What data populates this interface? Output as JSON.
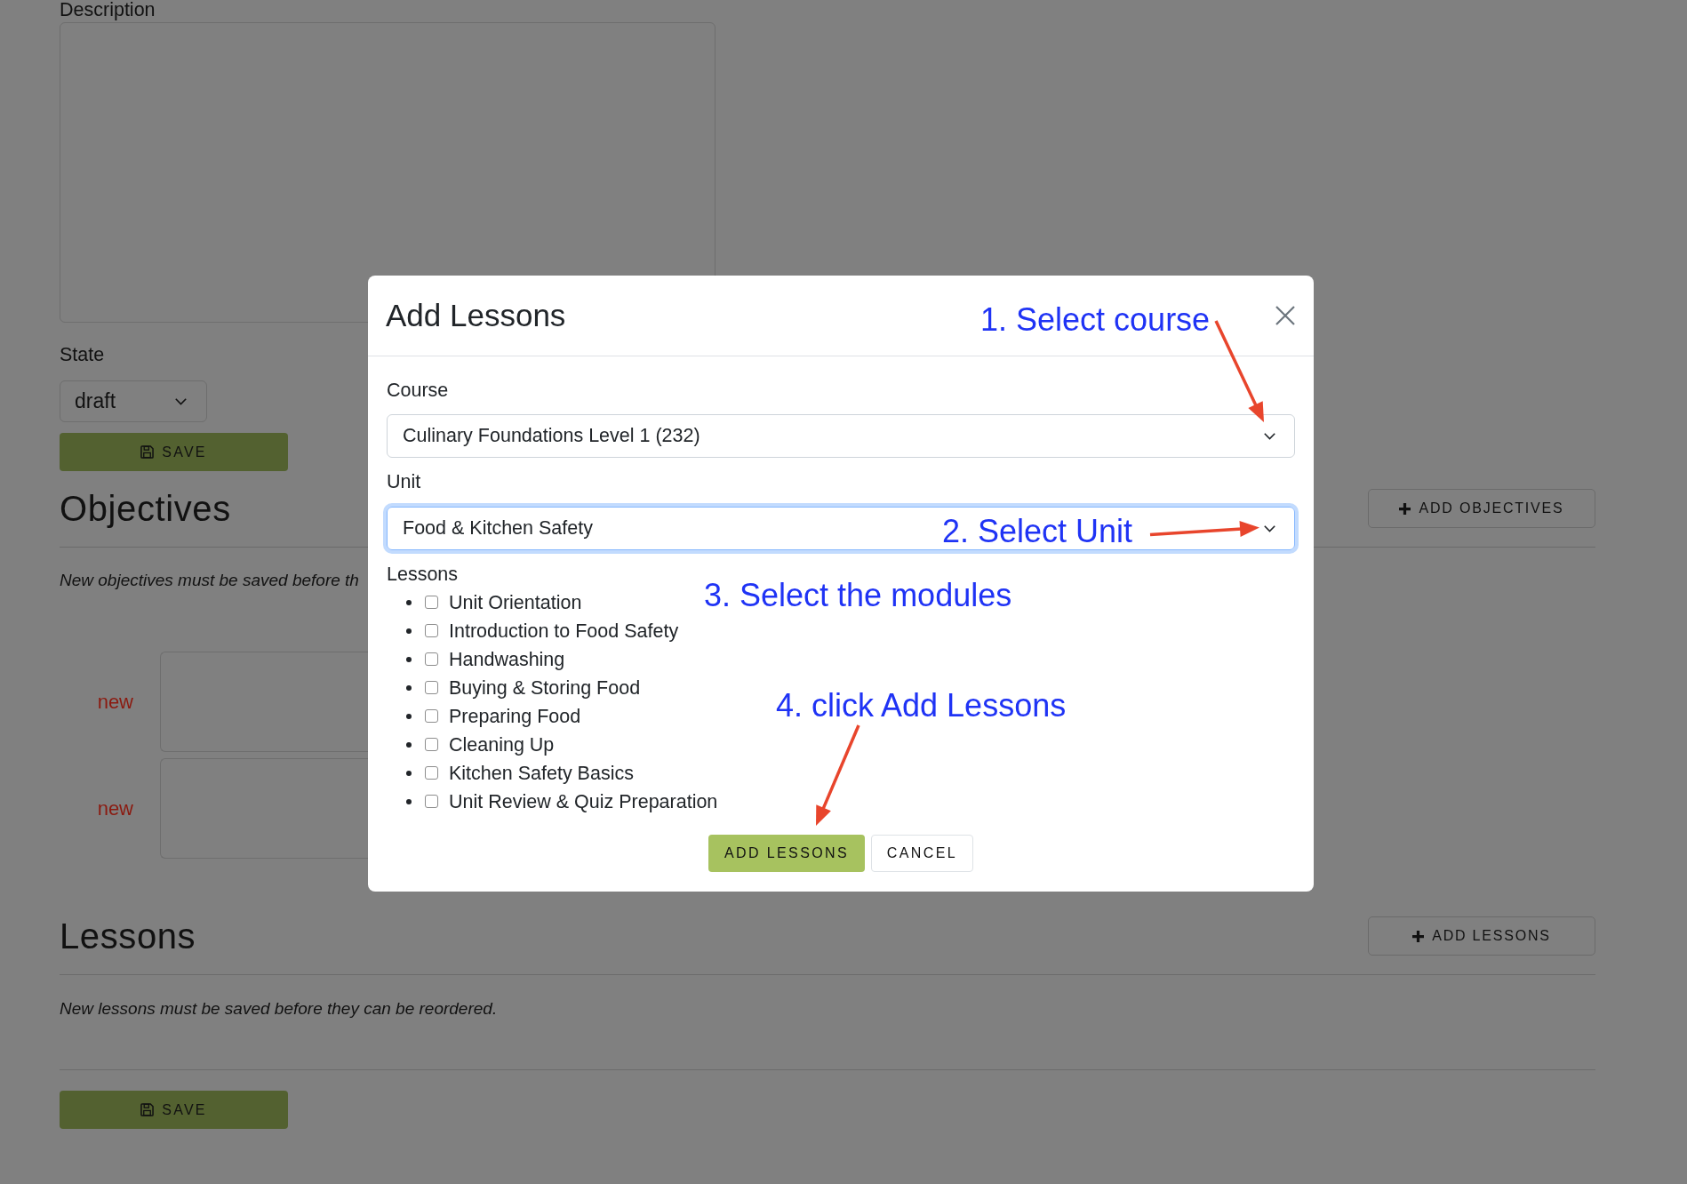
{
  "page": {
    "description": {
      "label": "Description"
    },
    "state": {
      "label": "State",
      "value": "draft"
    },
    "save_button": {
      "label": "SAVE"
    },
    "objectives": {
      "title": "Objectives",
      "add_button": {
        "label": "ADD OBJECTIVES"
      },
      "note": "New objectives must be saved before th",
      "items": [
        {
          "badge": "new"
        },
        {
          "badge": "new"
        }
      ]
    },
    "lessons": {
      "title": "Lessons",
      "add_button": {
        "label": "ADD LESSONS"
      },
      "note": "New lessons must be saved before they can be reordered."
    },
    "footer_save_button": {
      "label": "SAVE"
    }
  },
  "modal": {
    "title": "Add Lessons",
    "fields": [
      {
        "label": "Course",
        "value": "Culinary Foundations Level 1 (232)",
        "focused": false
      },
      {
        "label": "Unit",
        "value": "Food & Kitchen Safety",
        "focused": true
      }
    ],
    "lessons": {
      "label": "Lessons",
      "items": [
        {
          "label": "Unit Orientation",
          "checked": false
        },
        {
          "label": "Introduction to Food Safety",
          "checked": false
        },
        {
          "label": "Handwashing",
          "checked": false
        },
        {
          "label": "Buying & Storing Food",
          "checked": false
        },
        {
          "label": "Preparing Food",
          "checked": false
        },
        {
          "label": "Cleaning Up",
          "checked": false
        },
        {
          "label": "Kitchen Safety Basics",
          "checked": false
        },
        {
          "label": "Unit Review & Quiz Preparation",
          "checked": false
        }
      ]
    },
    "buttons": [
      {
        "label": "ADD LESSONS",
        "kind": "primary"
      },
      {
        "label": "CANCEL",
        "kind": "secondary"
      }
    ]
  },
  "annotations": [
    {
      "text": "1. Select course"
    },
    {
      "text": "2. Select Unit"
    },
    {
      "text": "3. Select the modules"
    },
    {
      "text": "4. click Add Lessons"
    }
  ]
}
